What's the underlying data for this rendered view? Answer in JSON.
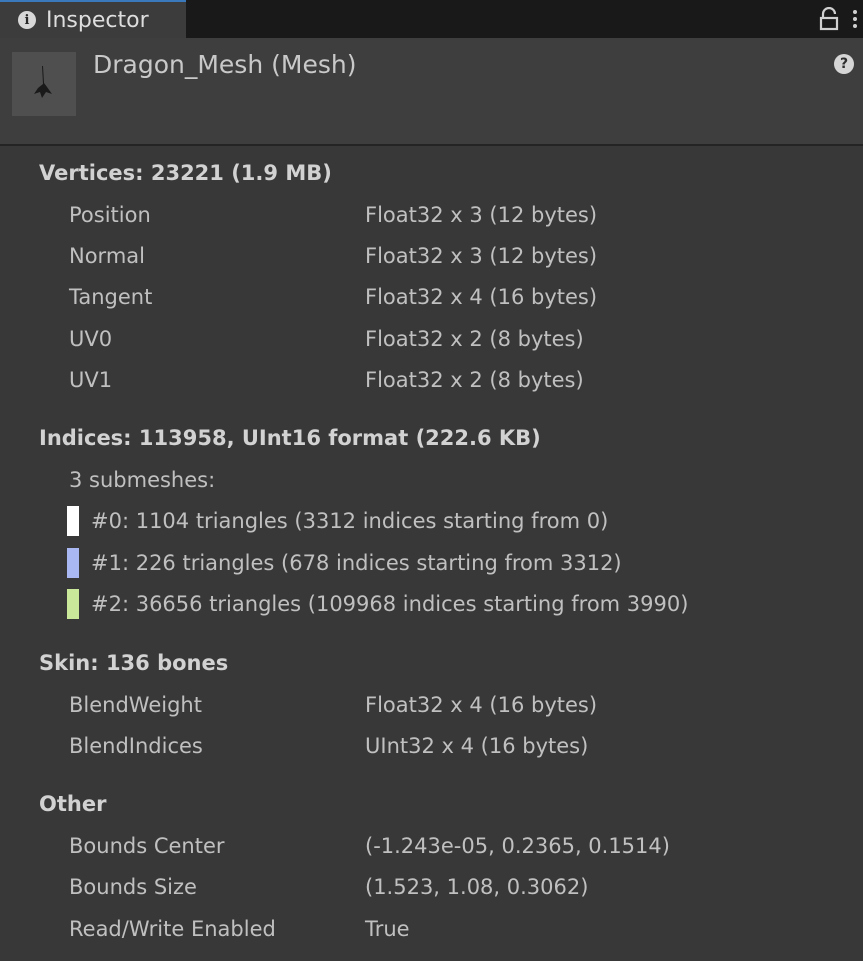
{
  "tab": {
    "label": "Inspector"
  },
  "header": {
    "title": "Dragon_Mesh (Mesh)"
  },
  "vertices": {
    "heading": "Vertices: 23221 (1.9 MB)",
    "rows": [
      {
        "label": "Position",
        "value": "Float32 x 3 (12 bytes)"
      },
      {
        "label": "Normal",
        "value": "Float32 x 3 (12 bytes)"
      },
      {
        "label": "Tangent",
        "value": "Float32 x 4 (16 bytes)"
      },
      {
        "label": "UV0",
        "value": "Float32 x 2 (8 bytes)"
      },
      {
        "label": "UV1",
        "value": "Float32 x 2 (8 bytes)"
      }
    ]
  },
  "indices": {
    "heading": "Indices: 113958, UInt16 format (222.6 KB)",
    "submesh_count": "3 submeshes:",
    "submeshes": [
      {
        "text": "#0: 1104 triangles (3312 indices starting from 0)",
        "color": "#ffffff"
      },
      {
        "text": "#1: 226 triangles (678 indices starting from 3312)",
        "color": "#a9b8f2"
      },
      {
        "text": "#2: 36656 triangles (109968 indices starting from 3990)",
        "color": "#c9e89a"
      }
    ]
  },
  "skin": {
    "heading": "Skin: 136 bones",
    "rows": [
      {
        "label": "BlendWeight",
        "value": "Float32 x 4 (16 bytes)"
      },
      {
        "label": "BlendIndices",
        "value": "UInt32 x 4 (16 bytes)"
      }
    ]
  },
  "other": {
    "heading": "Other",
    "rows": [
      {
        "label": "Bounds Center",
        "value": "(-1.243e-05, 0.2365, 0.1514)"
      },
      {
        "label": "Bounds Size",
        "value": "(1.523, 1.08, 0.3062)"
      },
      {
        "label": "Read/Write Enabled",
        "value": "True"
      }
    ]
  }
}
